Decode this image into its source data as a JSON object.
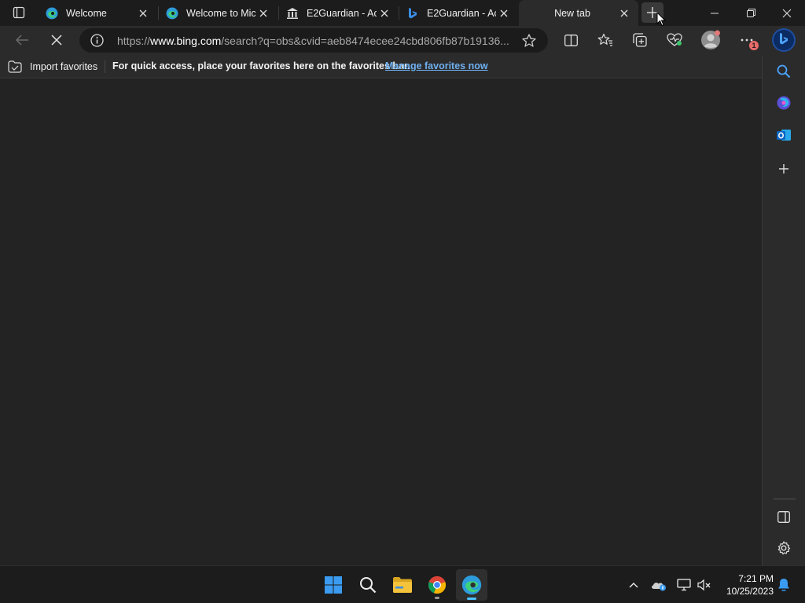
{
  "browser": {
    "tabs": [
      {
        "title": "Welcome",
        "favicon": "edge-icon"
      },
      {
        "title": "Welcome to Mic",
        "favicon": "edge-icon"
      },
      {
        "title": "E2Guardian - Ac",
        "favicon": "institution-icon"
      },
      {
        "title": "E2Guardian - Ac",
        "favicon": "bing-icon"
      },
      {
        "title": "New tab",
        "favicon": "none"
      }
    ],
    "active_tab_index": 4,
    "address": {
      "prefix": "https://",
      "host": "www.bing.com",
      "path": "/search?q=obs&cvid=aeb8474ecee24cbd806fb87b19136..."
    },
    "favorites_bar": {
      "import_label": "Import favorites",
      "message": "For quick access, place your favorites here on the favorites bar.",
      "link": "Manage favorites now"
    },
    "notification_badge": "1",
    "colors": {
      "accent": "#4cc2ff",
      "link": "#6fb0f0",
      "background": "#232323"
    }
  },
  "taskbar": {
    "apps": [
      "windows-start-icon",
      "search-icon",
      "file-explorer-icon",
      "chrome-icon",
      "edge-icon"
    ],
    "clock": {
      "time": "7:21 PM",
      "date": "10/25/2023"
    }
  }
}
